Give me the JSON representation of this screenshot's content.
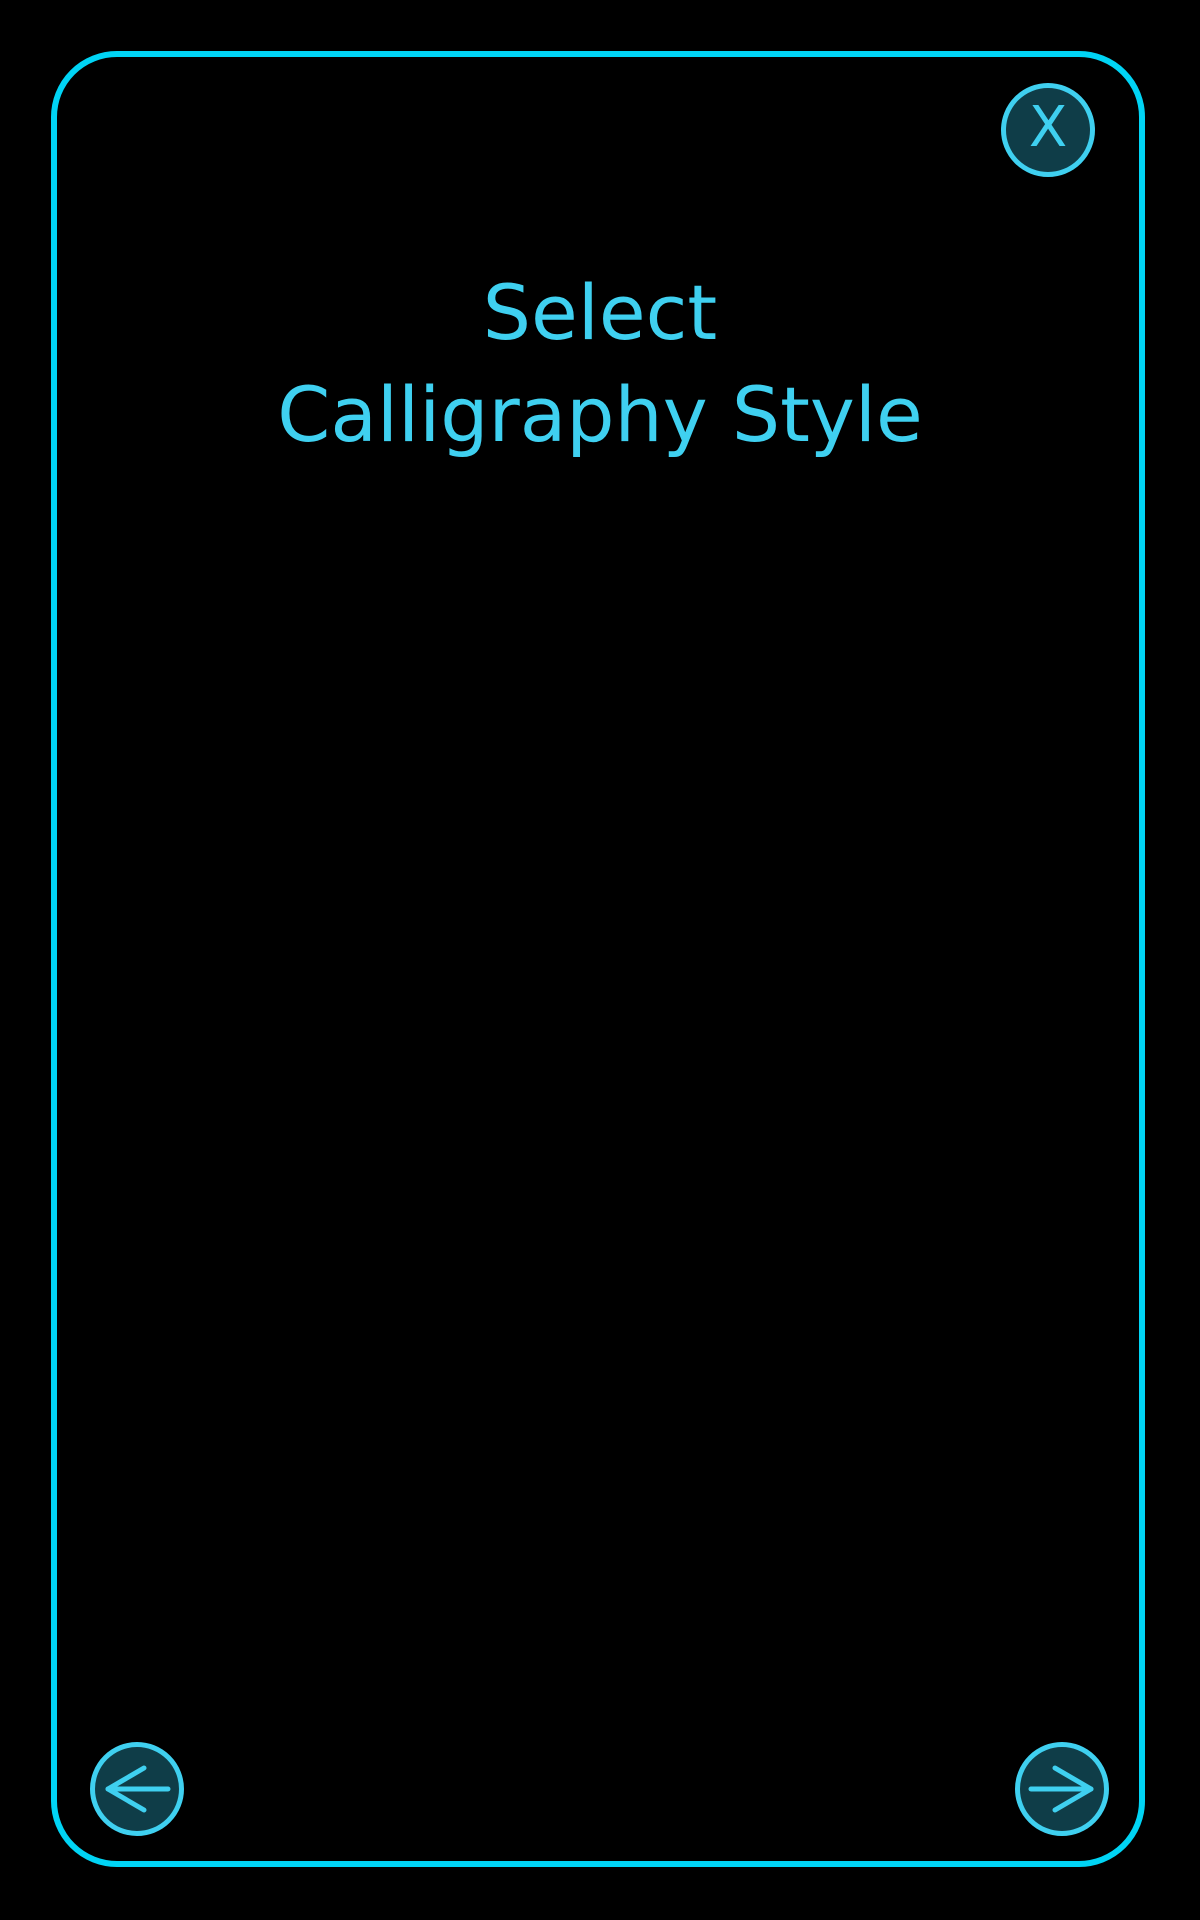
{
  "dialog": {
    "title_line1": "Select",
    "title_line2": "Calligraphy Style",
    "close_label": "X"
  },
  "navigation": {
    "prev_icon": "arrow-left-icon",
    "next_icon": "arrow-right-icon"
  },
  "colors": {
    "background": "#000000",
    "border_accent": "#00d4f5",
    "text_accent": "#3fd0f0",
    "button_fill": "#0f3d48"
  }
}
